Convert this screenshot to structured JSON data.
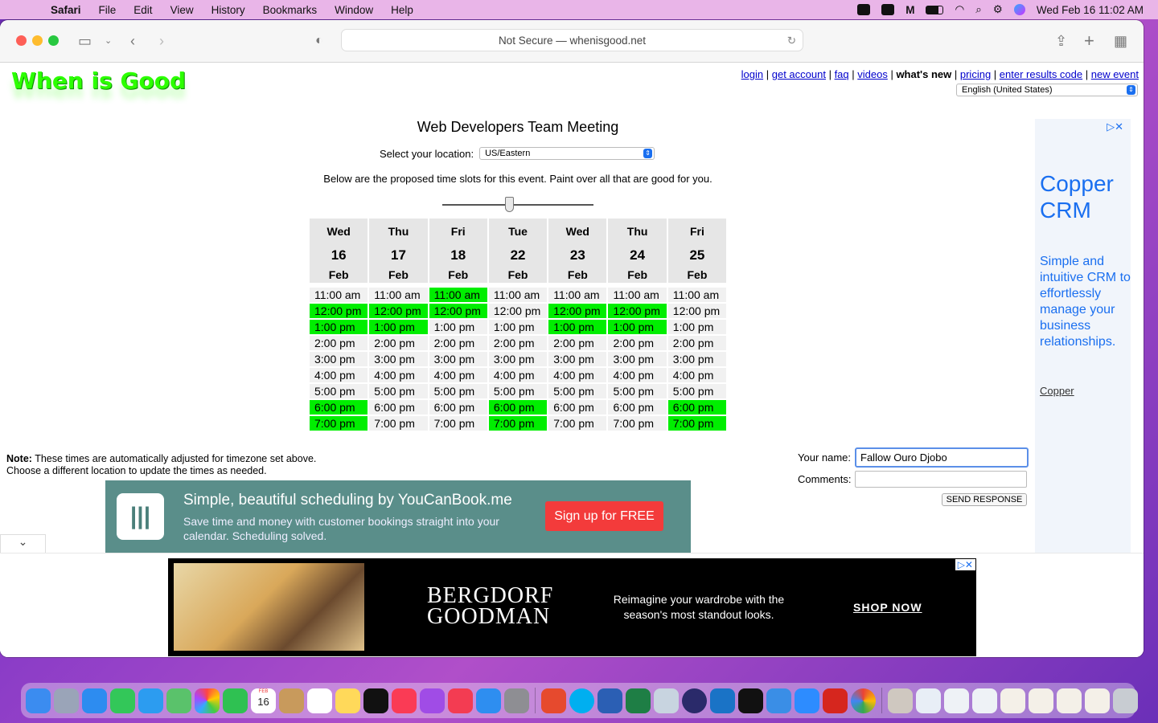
{
  "menubar": {
    "app": "Safari",
    "items": [
      "File",
      "Edit",
      "View",
      "History",
      "Bookmarks",
      "Window",
      "Help"
    ],
    "datetime": "Wed Feb 16  11:02 AM"
  },
  "browser": {
    "address": "Not Secure — whenisgood.net"
  },
  "site": {
    "logo": "When is Good",
    "links": [
      "login",
      "get account",
      "faq",
      "videos",
      "what's new",
      "pricing",
      "enter results code",
      "new event"
    ],
    "language": "English (United States)"
  },
  "event": {
    "title": "Web Developers Team Meeting",
    "location_label": "Select your location:",
    "location_value": "US/Eastern",
    "instructions": "Below are the proposed time slots for this event. Paint over all that are good for you."
  },
  "grid": {
    "days": [
      {
        "dow": "Wed",
        "day": "16",
        "month": "Feb",
        "on": [
          1,
          2,
          7,
          8
        ]
      },
      {
        "dow": "Thu",
        "day": "17",
        "month": "Feb",
        "on": [
          1,
          2
        ]
      },
      {
        "dow": "Fri",
        "day": "18",
        "month": "Feb",
        "on": [
          0,
          1
        ]
      },
      {
        "dow": "Tue",
        "day": "22",
        "month": "Feb",
        "on": [
          7,
          8
        ]
      },
      {
        "dow": "Wed",
        "day": "23",
        "month": "Feb",
        "on": [
          1,
          2
        ]
      },
      {
        "dow": "Thu",
        "day": "24",
        "month": "Feb",
        "on": [
          1,
          2
        ]
      },
      {
        "dow": "Fri",
        "day": "25",
        "month": "Feb",
        "on": [
          7,
          8
        ]
      }
    ],
    "times": [
      "11:00 am",
      "12:00 pm",
      "1:00 pm",
      "2:00 pm",
      "3:00 pm",
      "4:00 pm",
      "5:00 pm",
      "6:00 pm",
      "7:00 pm"
    ],
    "highlight_color": "#00ee00"
  },
  "note": {
    "bold": "Note:",
    "line1": " These times are automatically adjusted for timezone set above.",
    "line2": "Choose a different location to update the times as needed."
  },
  "response": {
    "name_label": "Your name:",
    "name_value": "Fallow Ouro Djobo",
    "comments_label": "Comments:",
    "send_label": "SEND RESPONSE"
  },
  "ad_right": {
    "headline": "Copper CRM",
    "body": "Simple and intuitive CRM to effortlessly manage your business relationships.",
    "link": "Copper"
  },
  "ad_ycb": {
    "headline": "Simple, beautiful scheduling by YouCanBook.me",
    "body": "Save time and money with customer bookings straight into your calendar. Scheduling solved.",
    "cta": "Sign up for FREE"
  },
  "ad_bergdorf": {
    "brand": "BERGDORF GOODMAN",
    "tagline": "Reimagine your wardrobe with the season's most standout looks.",
    "cta": "SHOP NOW"
  }
}
